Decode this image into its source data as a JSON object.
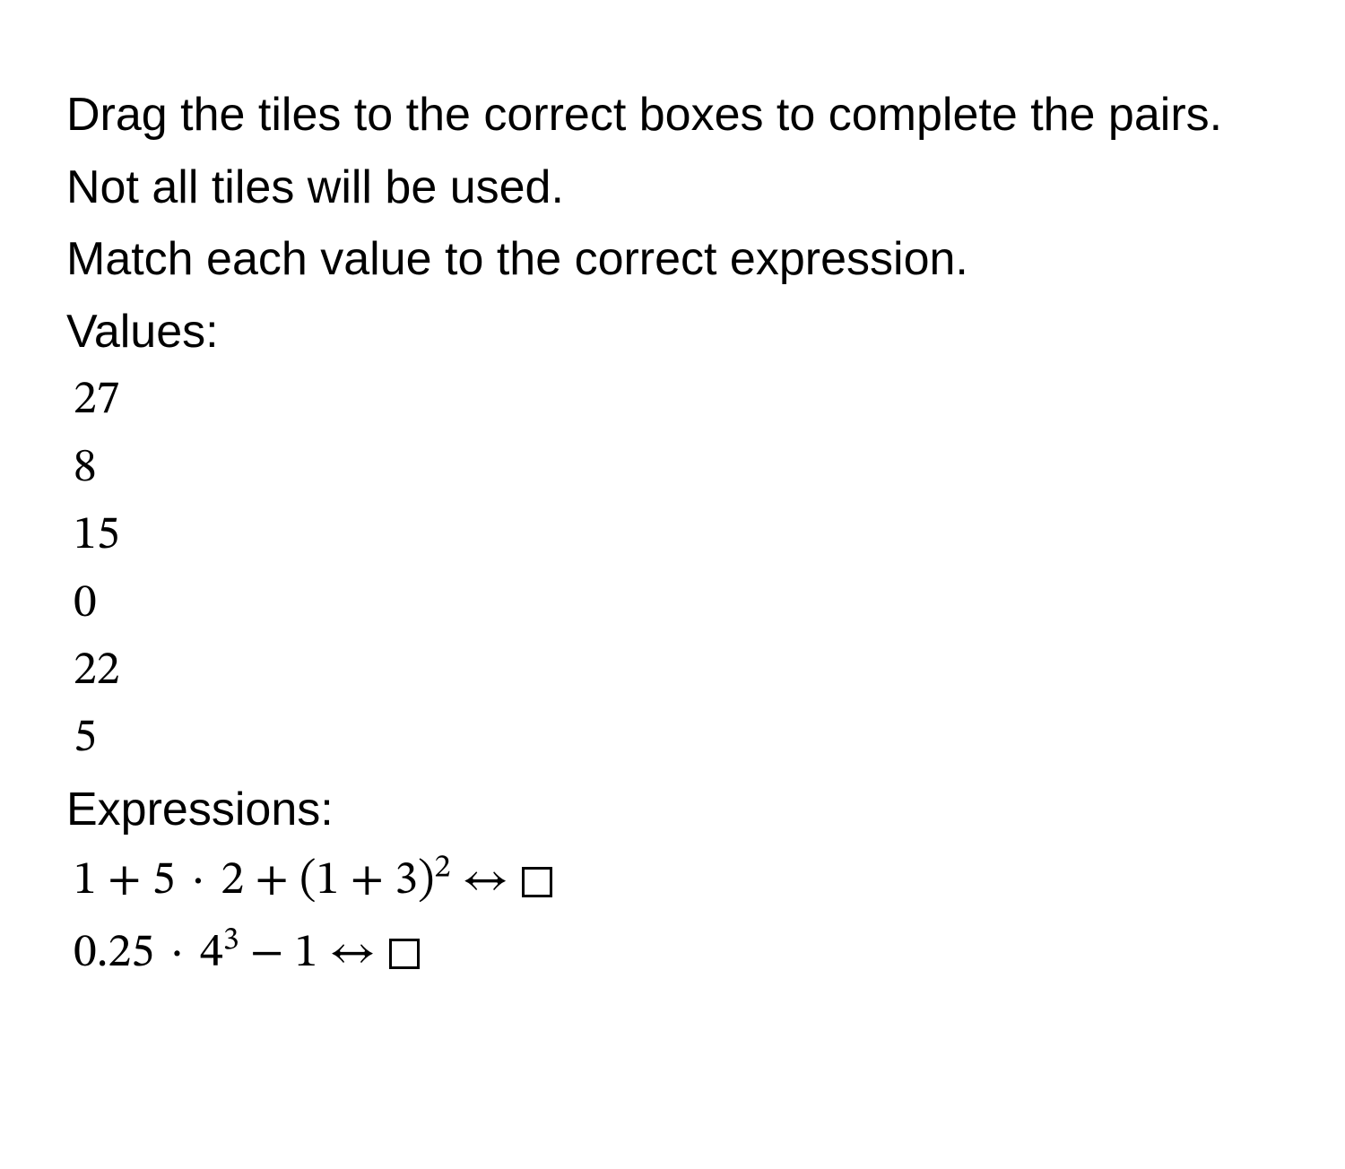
{
  "instructions": {
    "line1": "Drag the tiles to the correct boxes to complete the pairs. Not all tiles will be used.",
    "line2": "Match each value to the correct expression."
  },
  "values_heading": "Values:",
  "values": [
    "27",
    "8",
    "15",
    "0",
    "22",
    "5"
  ],
  "expressions_heading": "Expressions:",
  "expressions": [
    {
      "parts": {
        "a": "1 + 5",
        "dot": "·",
        "b": "2 + (1 + 3)",
        "sup": "2"
      }
    },
    {
      "parts": {
        "a": "0.25",
        "dot": "·",
        "b": "4",
        "sup": "3",
        "c": " − 1"
      }
    }
  ],
  "arrow": "↔"
}
